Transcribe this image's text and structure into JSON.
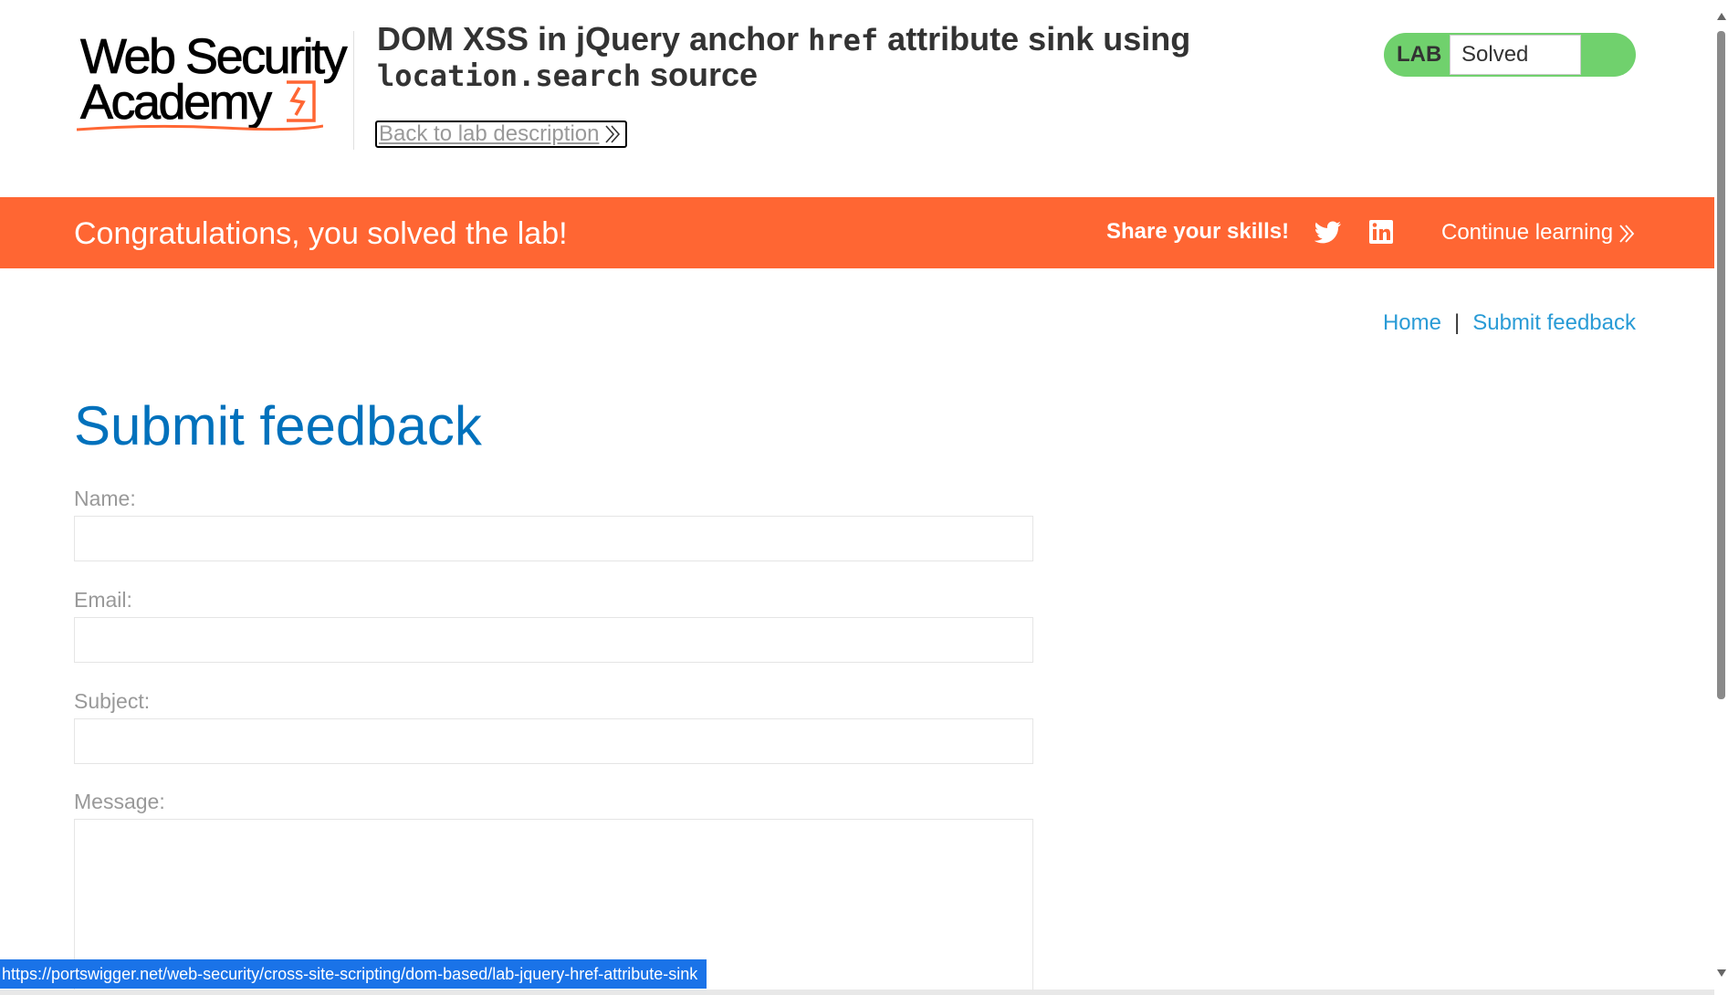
{
  "header": {
    "logo": {
      "line1": "Web Security",
      "line2": "Academy"
    },
    "title_prefix": "DOM XSS in jQuery anchor ",
    "title_code1": "href",
    "title_middle": " attribute sink using",
    "title_code2": "location.search",
    "title_suffix": " source",
    "back_link": "Back to lab description",
    "lab_label": "LAB",
    "lab_status": "Solved",
    "status_color": "#70d16d"
  },
  "banner": {
    "message": "Congratulations, you solved the lab!",
    "share": "Share your skills!",
    "twitter_icon": "twitter-icon",
    "linkedin_icon": "linkedin-icon",
    "continue": "Continue learning",
    "color": "#ff6633"
  },
  "nav": {
    "home": "Home",
    "separator": "|",
    "feedback": "Submit feedback"
  },
  "main": {
    "title": "Submit feedback",
    "fields": [
      {
        "label": "Name:",
        "value": ""
      },
      {
        "label": "Email:",
        "value": ""
      },
      {
        "label": "Subject:",
        "value": ""
      },
      {
        "label": "Message:",
        "value": ""
      }
    ]
  },
  "status_bar": {
    "url": "https://portswigger.net/web-security/cross-site-scripting/dom-based/lab-jquery-href-attribute-sink"
  }
}
